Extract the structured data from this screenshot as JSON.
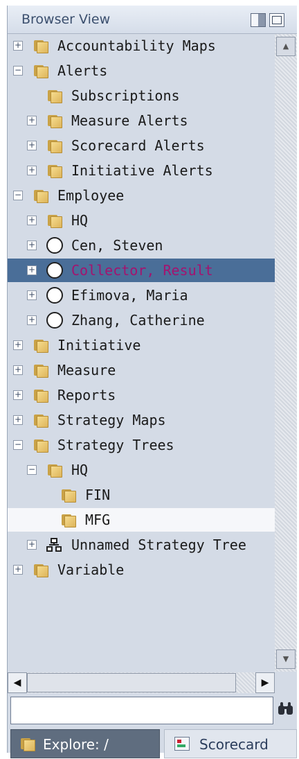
{
  "header": {
    "title": "Browser View"
  },
  "tree": [
    {
      "label": "Accountability Maps",
      "icon": "folder-icon",
      "expander": "+",
      "level": 0
    },
    {
      "label": "Alerts",
      "icon": "folder-icon",
      "expander": "−",
      "level": 0
    },
    {
      "label": "Subscriptions",
      "icon": "folder-icon",
      "expander": "",
      "level": 1
    },
    {
      "label": "Measure Alerts",
      "icon": "folder-icon",
      "expander": "+",
      "level": 1
    },
    {
      "label": "Scorecard Alerts",
      "icon": "folder-icon",
      "expander": "+",
      "level": 1
    },
    {
      "label": "Initiative Alerts",
      "icon": "folder-icon",
      "expander": "+",
      "level": 1
    },
    {
      "label": "Employee",
      "icon": "folder-icon",
      "expander": "−",
      "level": 0
    },
    {
      "label": "HQ",
      "icon": "folder-icon",
      "expander": "+",
      "level": 1
    },
    {
      "label": "Cen, Steven",
      "icon": "circle-icon",
      "expander": "+",
      "level": 1
    },
    {
      "label": "Collector, Result",
      "icon": "circle-icon",
      "expander": "+",
      "level": 1,
      "state": "selected"
    },
    {
      "label": "Efimova, Maria",
      "icon": "circle-icon",
      "expander": "+",
      "level": 1
    },
    {
      "label": "Zhang, Catherine",
      "icon": "circle-icon",
      "expander": "+",
      "level": 1
    },
    {
      "label": "Initiative",
      "icon": "folder-icon",
      "expander": "+",
      "level": 0
    },
    {
      "label": "Measure",
      "icon": "folder-icon",
      "expander": "+",
      "level": 0
    },
    {
      "label": "Reports",
      "icon": "folder-icon",
      "expander": "+",
      "level": 0
    },
    {
      "label": "Strategy Maps",
      "icon": "folder-icon",
      "expander": "+",
      "level": 0
    },
    {
      "label": "Strategy Trees",
      "icon": "folder-icon",
      "expander": "−",
      "level": 0
    },
    {
      "label": "HQ",
      "icon": "folder-icon",
      "expander": "−",
      "level": 1
    },
    {
      "label": "FIN",
      "icon": "folder-icon",
      "expander": "",
      "level": 2
    },
    {
      "label": "MFG",
      "icon": "folder-icon",
      "expander": "",
      "level": 2,
      "state": "hover"
    },
    {
      "label": "Unnamed Strategy Tree",
      "icon": "strategy-tree-icon",
      "expander": "+",
      "level": 1
    },
    {
      "label": "Variable",
      "icon": "folder-icon",
      "expander": "+",
      "level": 0
    }
  ],
  "search": {
    "value": "",
    "placeholder": ""
  },
  "tabs": {
    "explore_label": "Explore: /",
    "scorecard_label": "Scorecard"
  },
  "colors": {
    "selected_row_bg": "#4a6e98",
    "selected_row_text": "#a4136f",
    "panel_bg": "#d4dbe6"
  }
}
